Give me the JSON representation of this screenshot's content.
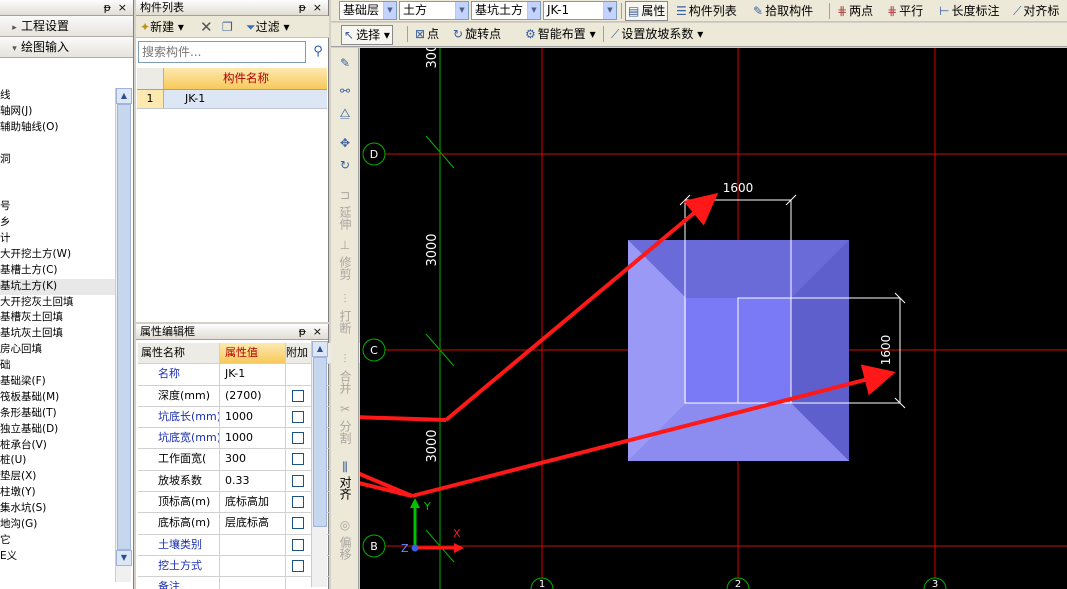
{
  "left_panel": {
    "pin": "ᵽ",
    "close": "×",
    "nav_buttons": [
      "工程设置",
      "绘图输入"
    ],
    "tree_items": [
      "线",
      "轴网(J)",
      "辅助轴线(O)",
      "",
      "洞",
      "",
      "",
      "号",
      "乡",
      "计",
      "大开挖土方(W)",
      "基槽土方(C)",
      "基坑土方(K)",
      "大开挖灰土回填",
      "基槽灰土回填",
      "基坑灰土回填",
      "房心回填",
      "础",
      "基础梁(F)",
      "筏板基础(M)",
      "条形基础(T)",
      "独立基础(D)",
      "桩承台(V)",
      "桩(U)",
      "垫层(X)",
      "柱墩(Y)",
      "集水坑(S)",
      "地沟(G)",
      "它",
      "E义"
    ],
    "selected_index": 12
  },
  "component_list": {
    "title": "构件列表",
    "new_label": "新建",
    "filter_label": "过滤",
    "search_placeholder": "搜索构件...",
    "column_name": "构件名称",
    "rows": [
      {
        "num": "1",
        "name": "JK-1"
      }
    ]
  },
  "properties": {
    "title": "属性编辑框",
    "header": {
      "name": "属性名称",
      "value": "属性值",
      "extra": "附加"
    },
    "rows": [
      {
        "name": "名称",
        "value": "JK-1",
        "blue": true,
        "check": false
      },
      {
        "name": "深度(mm)",
        "value": "(2700)",
        "blue": false,
        "check": true
      },
      {
        "name": "坑底长(mm)",
        "value": "1000",
        "blue": true,
        "check": true
      },
      {
        "name": "坑底宽(mm)",
        "value": "1000",
        "blue": true,
        "check": true
      },
      {
        "name": "工作面宽(",
        "value": "300",
        "blue": false,
        "check": true
      },
      {
        "name": "放坡系数",
        "value": "0.33",
        "blue": false,
        "check": true
      },
      {
        "name": "顶标高(m)",
        "value": "底标高加",
        "blue": false,
        "check": true
      },
      {
        "name": "底标高(m)",
        "value": "层底标高",
        "blue": false,
        "check": true
      },
      {
        "name": "土壤类别",
        "value": "",
        "blue": true,
        "check": true
      },
      {
        "name": "挖土方式",
        "value": "",
        "blue": true,
        "check": true
      },
      {
        "name": "备注",
        "value": "",
        "blue": true,
        "check": false
      }
    ]
  },
  "toolbar1": {
    "combos": [
      "基础层",
      "土方",
      "基坑土方",
      "JK-1"
    ],
    "buttons": [
      "属性",
      "构件列表",
      "拾取构件",
      "两点",
      "平行",
      "长度标注",
      "对齐标"
    ]
  },
  "toolbar2": {
    "buttons": [
      "选择",
      "点",
      "旋转点",
      "智能布置",
      "设置放坡系数"
    ]
  },
  "side_toolbar": {
    "labels": [
      "延伸",
      "修剪",
      "打断",
      "合并",
      "分割",
      "对齐",
      "偏移"
    ]
  },
  "canvas": {
    "axis_labels": [
      "D",
      "C",
      "B"
    ],
    "column_labels": [
      "1",
      "2",
      "3"
    ],
    "dims": [
      "3000",
      "3000",
      "3000"
    ],
    "dim_width": "1600",
    "dim_height": "1600",
    "ucs": {
      "y": "Y",
      "x": "X",
      "z": "Z"
    },
    "colors": {
      "grid": "#e00000",
      "green": "#00b000",
      "pit_outer": "#8080e8",
      "pit_inner": "#7a7af6"
    }
  }
}
